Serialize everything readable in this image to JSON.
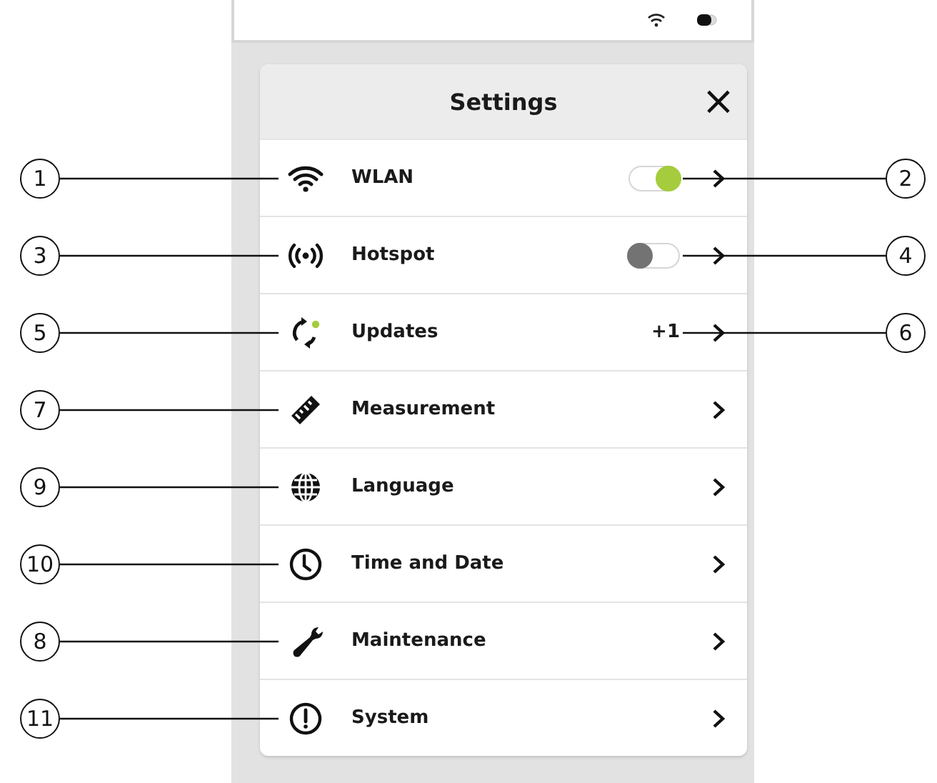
{
  "header": {
    "title": "Settings",
    "close": "×"
  },
  "items": [
    {
      "label": "WLAN",
      "kind": "toggle",
      "on": true,
      "callout": "1",
      "right_callout": "2"
    },
    {
      "label": "Hotspot",
      "kind": "toggle",
      "on": false,
      "callout": "3",
      "right_callout": "4"
    },
    {
      "label": "Updates",
      "kind": "badge",
      "badge": "+1",
      "callout": "5",
      "right_callout": "6"
    },
    {
      "label": "Measurement",
      "kind": "plain",
      "callout": "7"
    },
    {
      "label": "Language",
      "kind": "plain",
      "callout": "9"
    },
    {
      "label": "Time and Date",
      "kind": "plain",
      "callout": "10"
    },
    {
      "label": "Maintenance",
      "kind": "plain",
      "callout": "8"
    },
    {
      "label": "System",
      "kind": "plain",
      "callout": "11"
    }
  ]
}
